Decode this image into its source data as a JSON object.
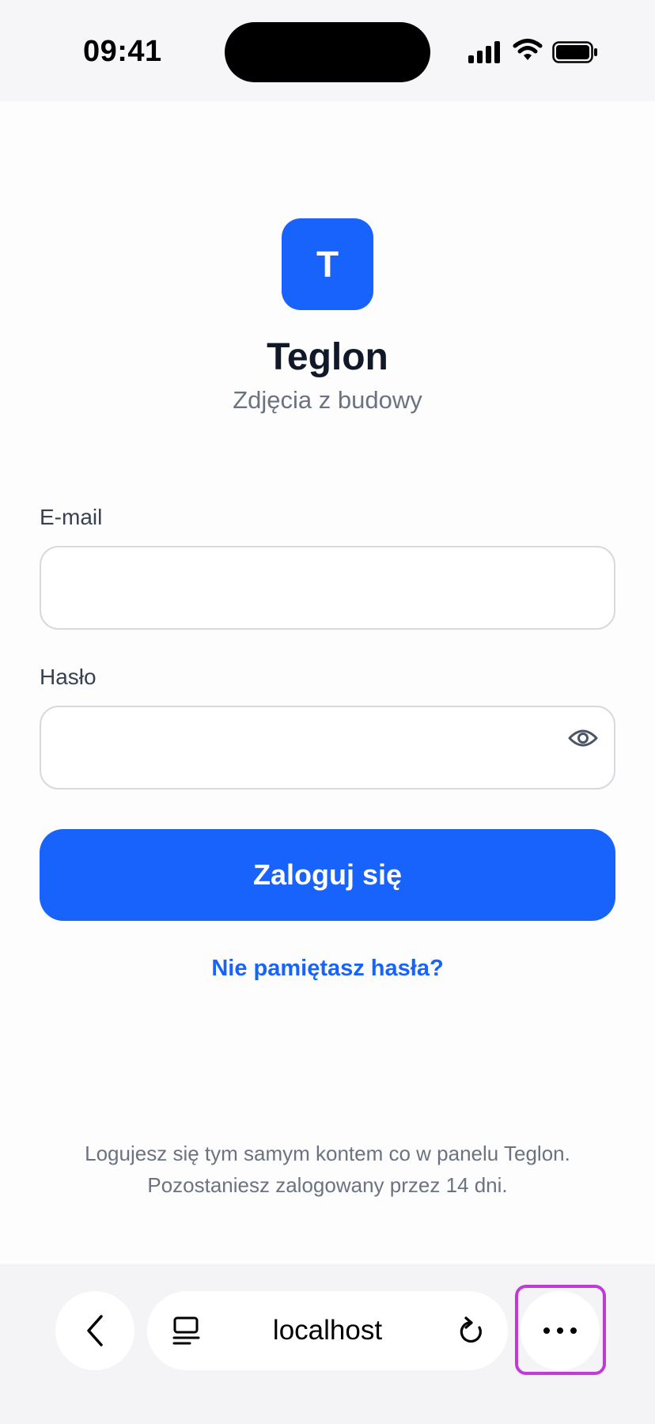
{
  "status_bar": {
    "time": "09:41",
    "icons": [
      "signal-icon",
      "wifi-icon",
      "battery-icon"
    ]
  },
  "header": {
    "logo_letter": "T",
    "title": "Teglon",
    "subtitle": "Zdjęcia z budowy"
  },
  "form": {
    "email_label": "E-mail",
    "email_value": "",
    "password_label": "Hasło",
    "password_value": "",
    "login_button": "Zaloguj się",
    "forgot_link": "Nie pamiętasz hasła?"
  },
  "footer": {
    "line1": "Logujesz się tym samym kontem co w panelu Teglon.",
    "line2": "Pozostaniesz zalogowany przez 14 dni."
  },
  "browser": {
    "url": "localhost"
  },
  "colors": {
    "accent": "#1863fb",
    "highlight": "#c13ad6"
  }
}
